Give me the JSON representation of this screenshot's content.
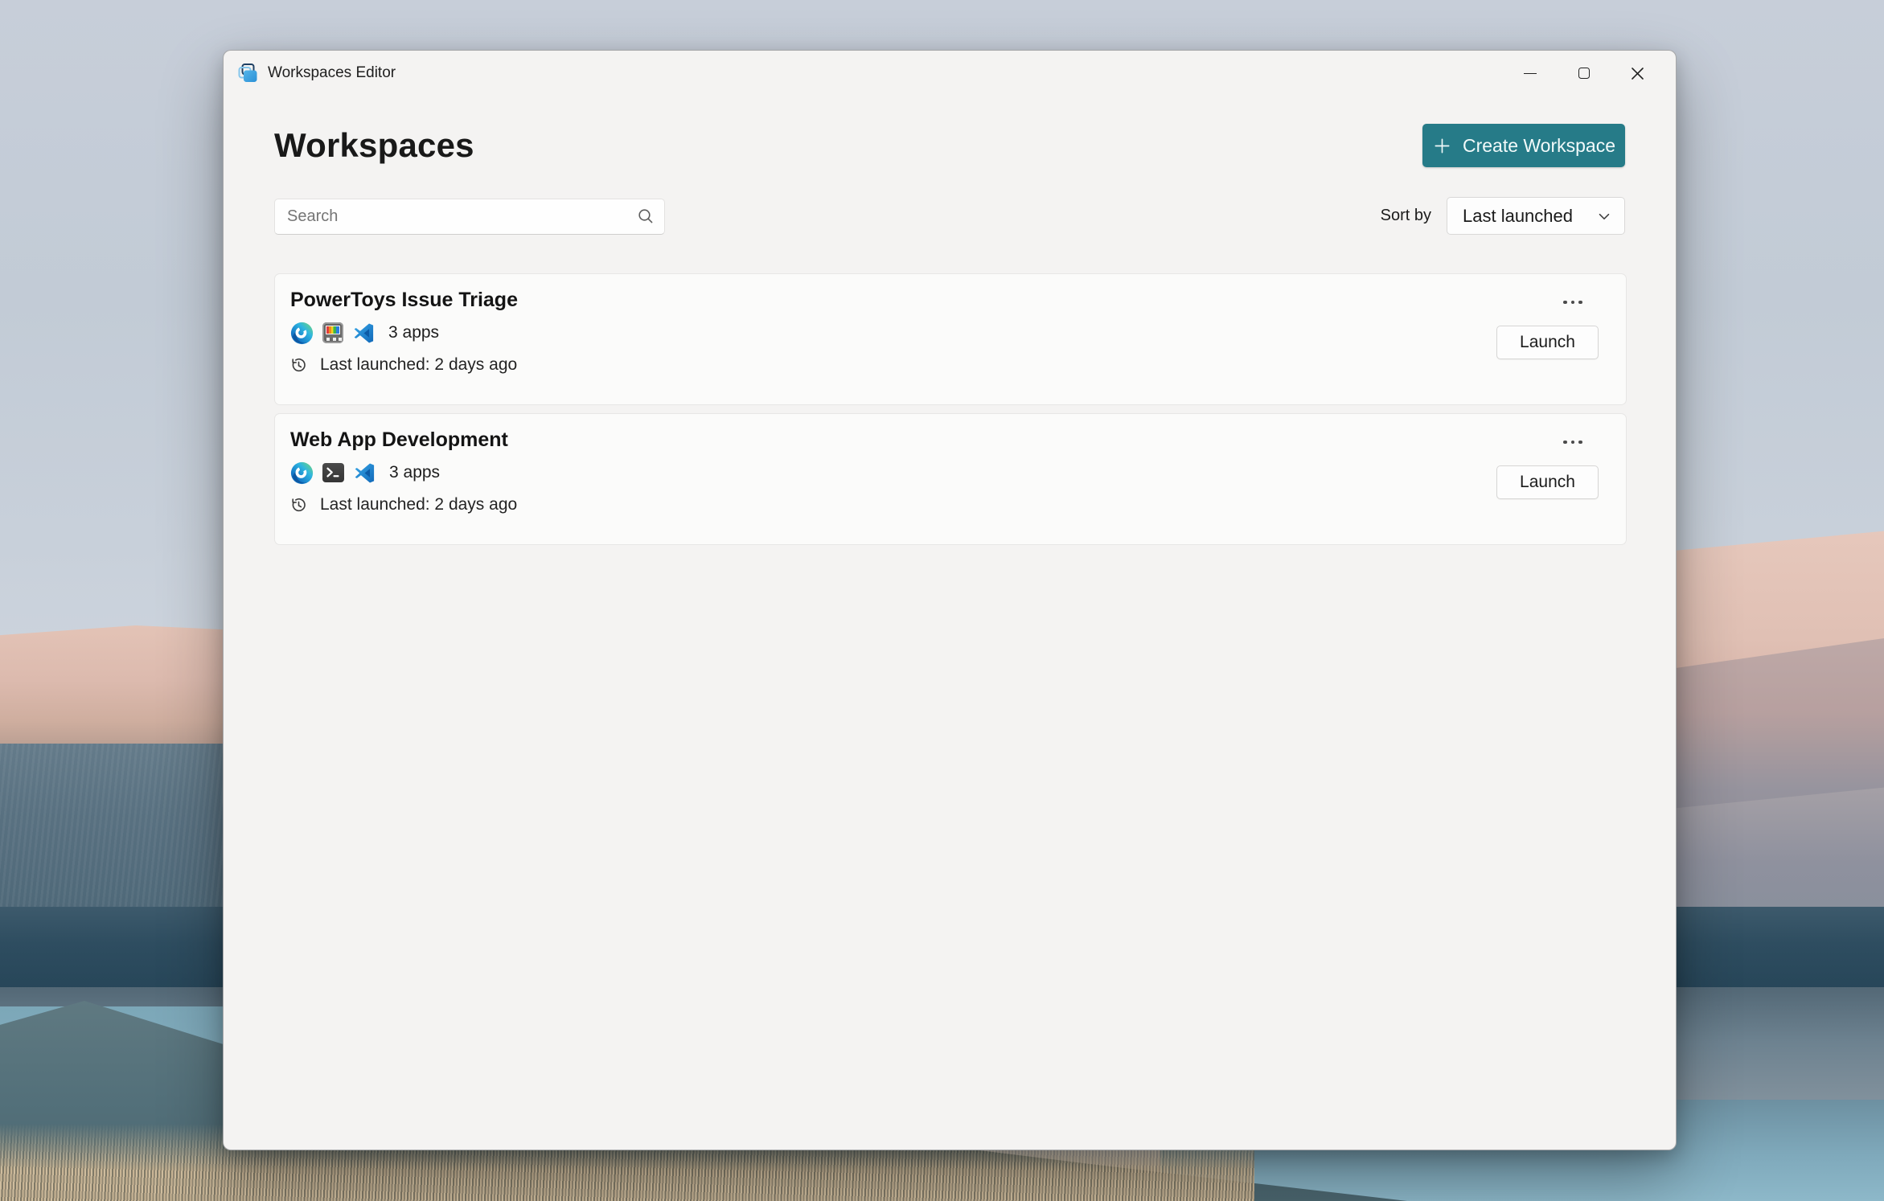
{
  "colors": {
    "accent": "#267b88"
  },
  "titlebar": {
    "title": "Workspaces Editor"
  },
  "header": {
    "title": "Workspaces",
    "create_button_label": "Create Workspace"
  },
  "toolbar": {
    "search_placeholder": "Search",
    "sort_label": "Sort by",
    "sort_value": "Last launched"
  },
  "workspaces": [
    {
      "name": "PowerToys Issue Triage",
      "app_icons": [
        "microsoft-edge",
        "powertoys",
        "vs-code"
      ],
      "apps_count": "3 apps",
      "last_launched": "Last launched: 2 days ago",
      "launch_label": "Launch"
    },
    {
      "name": "Web App Development",
      "app_icons": [
        "microsoft-edge",
        "terminal",
        "vs-code"
      ],
      "apps_count": "3 apps",
      "last_launched": "Last launched: 2 days ago",
      "launch_label": "Launch"
    }
  ]
}
